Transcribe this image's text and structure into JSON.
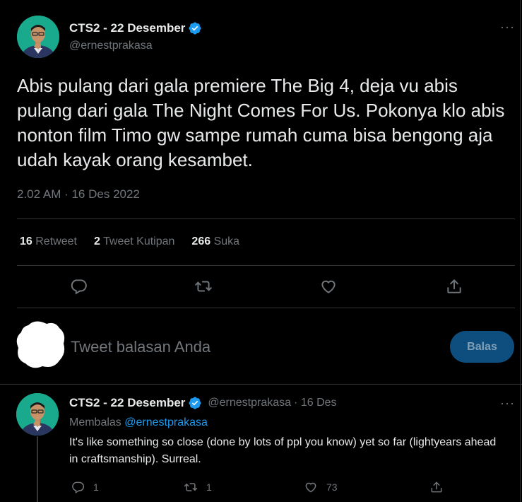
{
  "tweet": {
    "author_name": "CTS2 - 22 Desember",
    "author_handle": "@ernestprakasa",
    "more_label": "···",
    "text": "Abis pulang dari gala premiere The Big 4, deja vu abis pulang dari gala The Night Comes For Us. Pokonya klo abis nonton film Timo gw sampe rumah cuma bisa bengong aja udah kayak orang kesambet.",
    "timestamp": "2.02 AM · 16 Des 2022",
    "stats": {
      "retweets_count": "16",
      "retweets_label": "Retweet",
      "quotes_count": "2",
      "quotes_label": "Tweet Kutipan",
      "likes_count": "266",
      "likes_label": "Suka"
    },
    "actions": [
      "reply-icon",
      "retweet-icon",
      "like-icon",
      "share-icon"
    ]
  },
  "composer": {
    "placeholder": "Tweet balasan Anda",
    "reply_button": "Balas"
  },
  "reply": {
    "author_name": "CTS2 - 22 Desember",
    "author_handle": "@ernestprakasa",
    "date": "· 16 Des",
    "replying_prefix": "Membalas",
    "replying_to": "@ernestprakasa",
    "more_label": "···",
    "text": "It's like something so close (done by lots of ppl you know) yet so far (lightyears ahead in craftsmanship). Surreal.",
    "reply_count": "1",
    "retweet_count": "1",
    "like_count": "73"
  },
  "colors": {
    "background": "#000000",
    "text": "#e7e9ea",
    "muted": "#71767b",
    "accent": "#1d9bf0",
    "button_disabled": "#0e4e7f"
  }
}
